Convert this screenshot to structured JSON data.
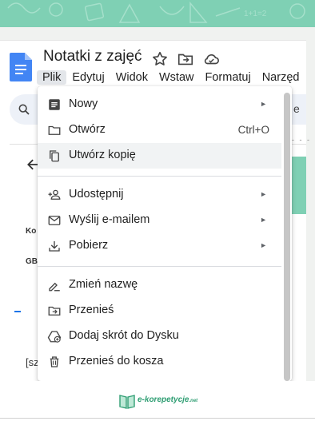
{
  "banner": {
    "doodle_text": "1+1=2"
  },
  "document": {
    "title": "Notatki z zajęć"
  },
  "title_icons": [
    "star-icon",
    "move-to-folder-icon",
    "cloud-status-icon"
  ],
  "menubar": {
    "items": [
      "Plik",
      "Edytuj",
      "Widok",
      "Wstaw",
      "Formatuj",
      "Narzęd"
    ]
  },
  "search_field": {
    "partial_text": "e"
  },
  "left_panel": {
    "label_ko": "Ko",
    "label_gb": "GB",
    "text_sz": "[sz"
  },
  "ruler": {
    "ticks": "- - -"
  },
  "file_menu": {
    "items": [
      {
        "label": "Nowy",
        "icon": "document-icon",
        "submenu": true
      },
      {
        "label": "Otwórz",
        "icon": "folder-icon",
        "shortcut": "Ctrl+O"
      },
      {
        "label": "Utwórz kopię",
        "icon": "copy-icon",
        "highlighted": true
      },
      {
        "label": "Udostępnij",
        "icon": "person-add-icon",
        "submenu": true
      },
      {
        "label": "Wyślij e-mailem",
        "icon": "mail-icon",
        "submenu": true
      },
      {
        "label": "Pobierz",
        "icon": "download-icon",
        "submenu": true
      },
      {
        "label": "Zmień nazwę",
        "icon": "rename-icon"
      },
      {
        "label": "Przenieś",
        "icon": "move-folder-icon"
      },
      {
        "label": "Dodaj skrót do Dysku",
        "icon": "drive-shortcut-icon"
      },
      {
        "label": "Przenieś do kosza",
        "icon": "trash-icon"
      }
    ],
    "submenu_arrow": "►"
  },
  "footer": {
    "brand": "e-korepetycje",
    "brand_suffix": ".net"
  },
  "colors": {
    "banner": "#7fd0b4",
    "doc_blue": "#4285f4",
    "brand_green": "#2f9e73",
    "highlight": "#f1f3f4"
  }
}
